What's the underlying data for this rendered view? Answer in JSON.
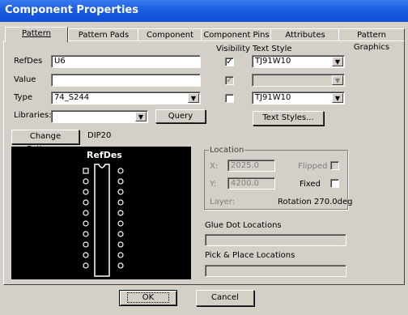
{
  "window": {
    "title": "Component Properties"
  },
  "tabs": [
    "Pattern",
    "Pattern Pads",
    "Component",
    "Component Pins",
    "Attributes",
    "Pattern Graphics"
  ],
  "form": {
    "refdes_label": "RefDes",
    "refdes_value": "U6",
    "value_label": "Value",
    "value_value": "",
    "type_label": "Type",
    "type_value": "74_S244",
    "libraries_label": "Libraries:",
    "libraries_value": "",
    "query_button": "Query",
    "visibility_label": "Visibility",
    "text_style_label": "Text Style",
    "refdes_style": "TJ91W10",
    "value_style": "",
    "type_style": "TJ91W10",
    "text_styles_button": "Text Styles...",
    "visibility": {
      "refdes": true,
      "value": true,
      "type": false
    }
  },
  "pattern": {
    "change_button": "Change Pattern...",
    "name": "DIP20",
    "preview_label": "RefDes",
    "pins_per_side": 10
  },
  "location": {
    "group_label": "Location",
    "x_label": "X:",
    "x_value": "2025.0",
    "y_label": "Y:",
    "y_value": "4200.0",
    "flipped_label": "Flipped",
    "fixed_label": "Fixed",
    "layer_label": "Layer:",
    "rotation_text": "Rotation  270.0deg"
  },
  "glue": {
    "label": "Glue Dot Locations",
    "value": ""
  },
  "pick": {
    "label": "Pick & Place Locations",
    "value": ""
  },
  "footer": {
    "ok": "OK",
    "cancel": "Cancel"
  }
}
